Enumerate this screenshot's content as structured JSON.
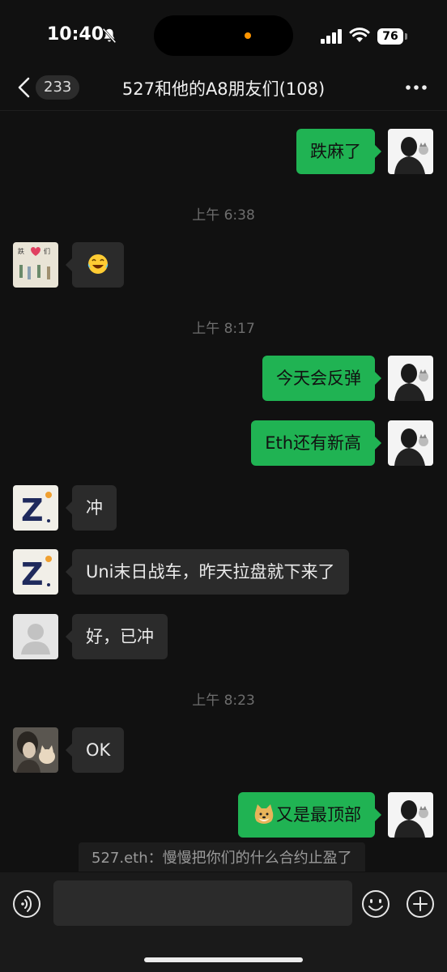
{
  "status_bar": {
    "time": "10:40",
    "battery": "76"
  },
  "nav": {
    "unread_count": "233",
    "title": "527和他的A8朋友们(108)"
  },
  "colors": {
    "accent_green": "#20b353",
    "background": "#111111",
    "incoming_bubble": "#2b2b2b"
  },
  "messages": [
    {
      "side": "out",
      "text": "跌麻了"
    },
    {
      "type": "time",
      "text": "上午 6:38"
    },
    {
      "side": "in",
      "emoji": "tears-of-joy-emoji"
    },
    {
      "type": "time",
      "text": "上午 8:17"
    },
    {
      "side": "out",
      "text": "今天会反弹"
    },
    {
      "side": "out",
      "text": "Eth还有新高"
    },
    {
      "side": "in",
      "text": "冲"
    },
    {
      "side": "in",
      "text": "Uni末日战车，昨天拉盘就下来了"
    },
    {
      "side": "in",
      "text": "好，已冲"
    },
    {
      "type": "time",
      "text": "上午 8:23"
    },
    {
      "side": "in",
      "text": "OK"
    },
    {
      "side": "out",
      "text": "又是最顶部",
      "emoji": "doge-emoji"
    }
  ],
  "quote": {
    "text": "527.eth：慢慢把你们的什么合约止盈了"
  },
  "input": {
    "placeholder": ""
  }
}
